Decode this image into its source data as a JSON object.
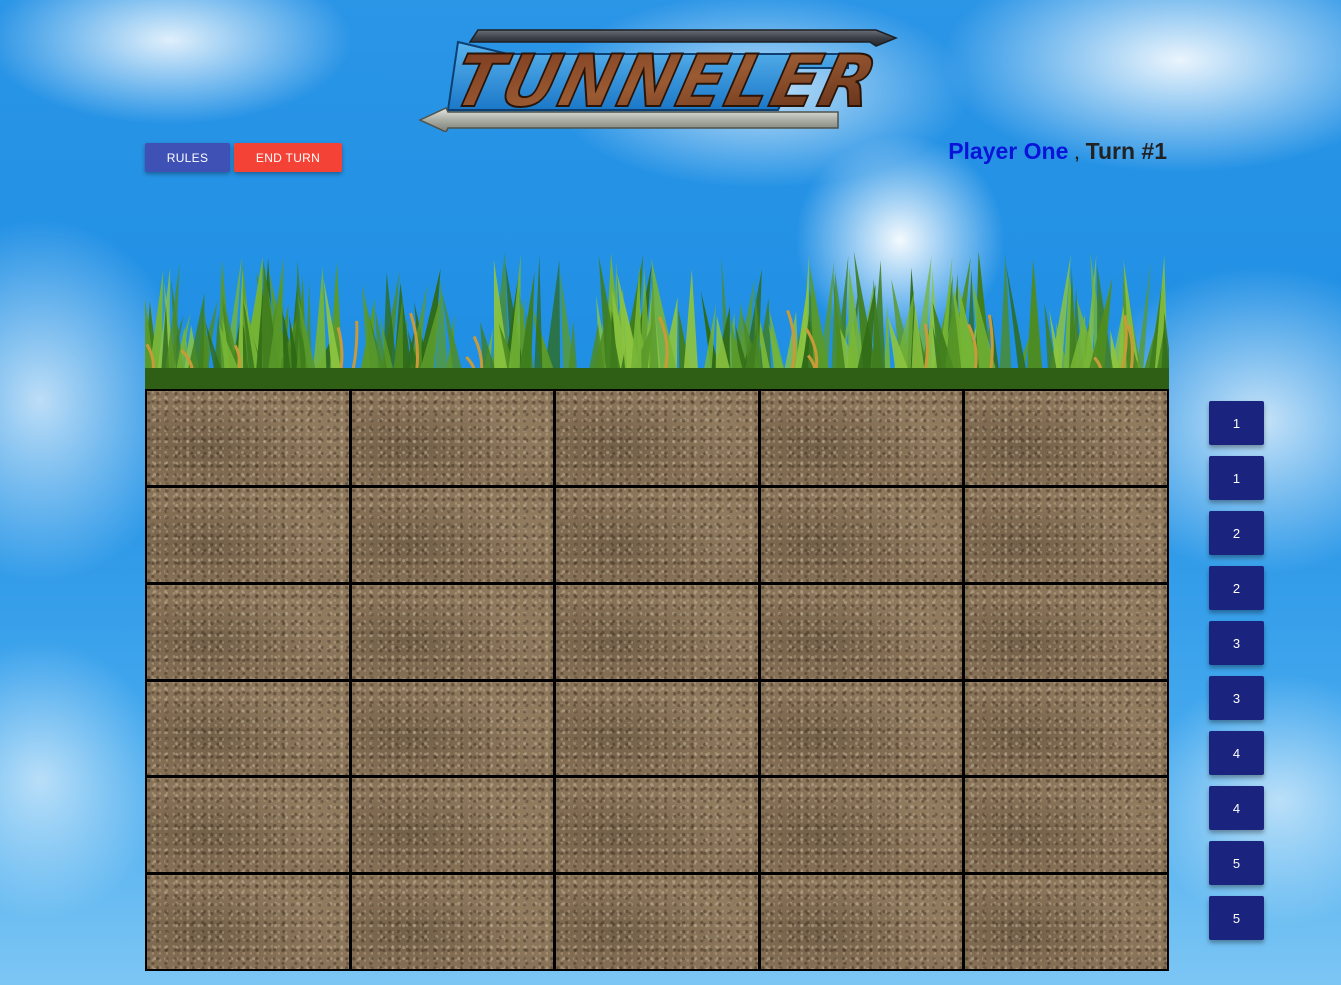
{
  "title": {
    "logo_text": "TUNNELER"
  },
  "toolbar": {
    "rules_label": "RULES",
    "end_turn_label": "END TURN"
  },
  "status": {
    "player": "Player One",
    "separator": ",",
    "turn": "Turn #1"
  },
  "board": {
    "rows": 6,
    "columns": 5,
    "tile": "dirt"
  },
  "pieces": [
    "1",
    "1",
    "2",
    "2",
    "3",
    "3",
    "4",
    "4",
    "5",
    "5"
  ],
  "colors": {
    "rules_button": "#3f51b5",
    "end_turn_button": "#f44336",
    "piece_button": "#1a237e",
    "player_name": "#0a14d9"
  }
}
